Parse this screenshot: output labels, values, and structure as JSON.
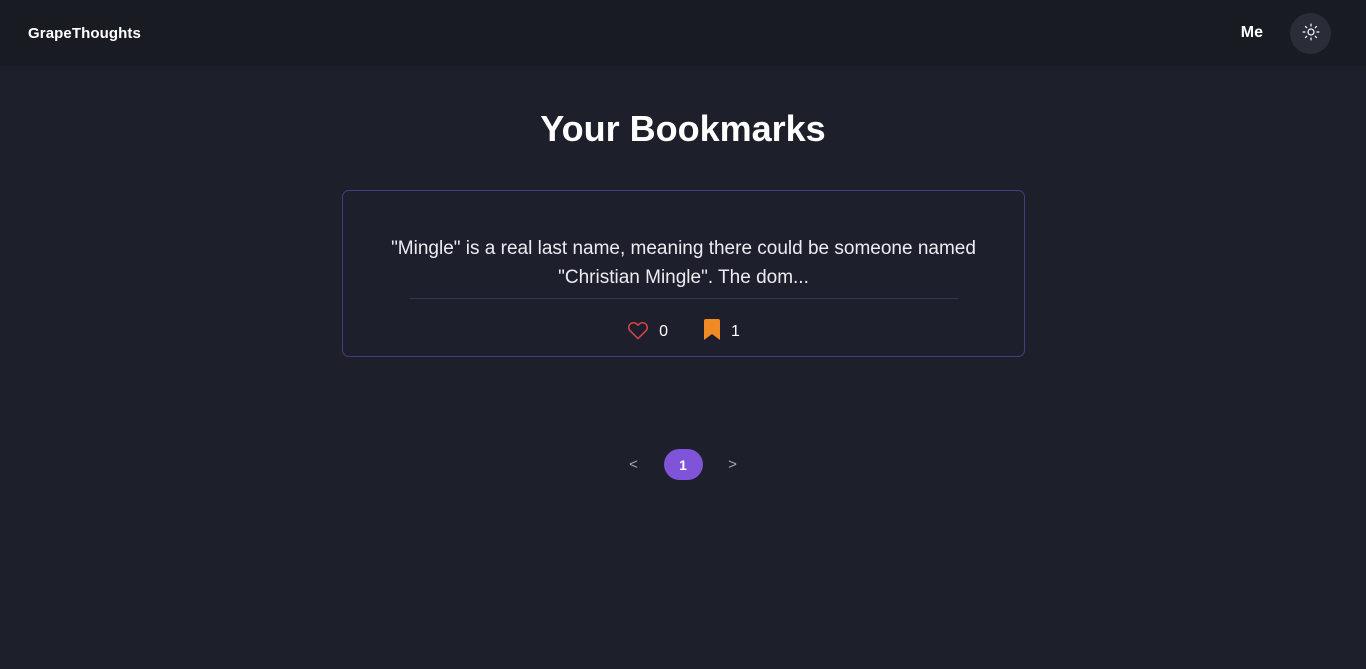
{
  "navbar": {
    "brand": "GrapeThoughts",
    "me_label": "Me",
    "theme_icon": "sun-icon"
  },
  "page": {
    "title": "Your Bookmarks"
  },
  "bookmarks": [
    {
      "text": "\"Mingle\" is a real last name, meaning there could be someone named \"Christian Mingle\". The dom...",
      "likes": "0",
      "bookmarks": "1",
      "like_icon": "heart-outline-icon",
      "bookmark_icon": "bookmark-filled-icon"
    }
  ],
  "pagination": {
    "prev": "<",
    "current": "1",
    "next": ">"
  },
  "colors": {
    "background": "#1d202b",
    "navbar": "#191b23",
    "accent": "#8054d8",
    "heart": "#e0434c",
    "bookmark": "#f08a24",
    "card_border": "#4a3b7a"
  }
}
